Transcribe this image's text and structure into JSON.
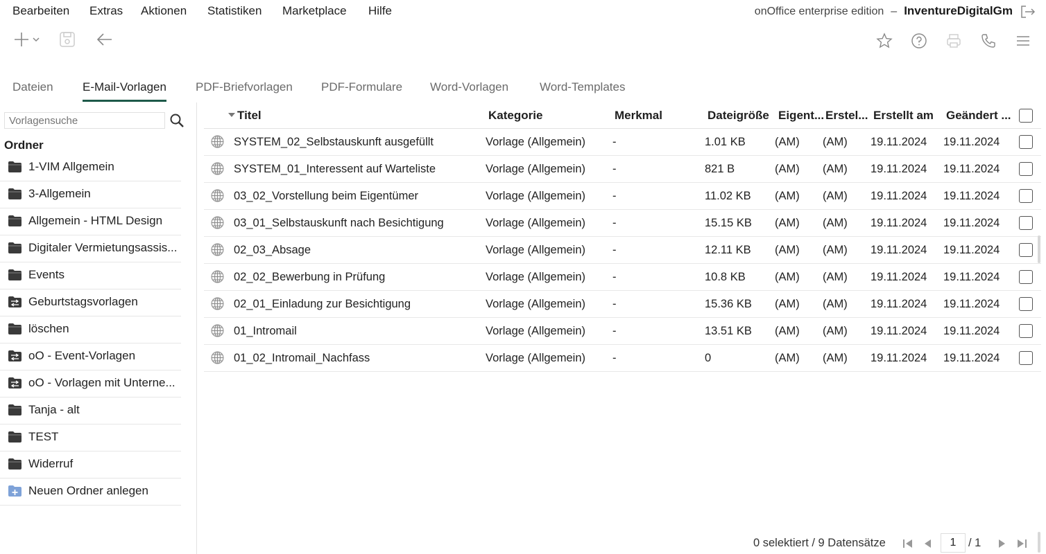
{
  "menu": {
    "items": [
      "Bearbeiten",
      "Extras",
      "Aktionen",
      "Statistiken",
      "Marketplace",
      "Hilfe"
    ],
    "edition": "onOffice enterprise edition",
    "separator": "–",
    "company": "InventureDigitalGm"
  },
  "toolbar": {
    "icons": [
      "plus-icon",
      "chevron-down-icon",
      "save-icon",
      "arrow-left-icon",
      "star-icon",
      "help-icon",
      "print-icon",
      "phone-icon",
      "menu-icon"
    ]
  },
  "tabs": [
    {
      "label": "Dateien",
      "active": false
    },
    {
      "label": "E-Mail-Vorlagen",
      "active": true
    },
    {
      "label": "PDF-Briefvorlagen",
      "active": false
    },
    {
      "label": "PDF-Formulare",
      "active": false
    },
    {
      "label": "Word-Vorlagen",
      "active": false
    },
    {
      "label": "Word-Templates",
      "active": false
    }
  ],
  "sidebar": {
    "search_placeholder": "Vorlagensuche",
    "heading": "Ordner",
    "folders": [
      {
        "label": "1-VIM Allgemein",
        "icon": "folder-icon"
      },
      {
        "label": "3-Allgemein",
        "icon": "folder-icon"
      },
      {
        "label": "Allgemein - HTML Design",
        "icon": "folder-icon"
      },
      {
        "label": "Digitaler Vermietungsassis...",
        "icon": "folder-icon"
      },
      {
        "label": "Events",
        "icon": "folder-icon"
      },
      {
        "label": "Geburtstagsvorlagen",
        "icon": "shared-folder-icon"
      },
      {
        "label": "löschen",
        "icon": "folder-icon"
      },
      {
        "label": "oO - Event-Vorlagen",
        "icon": "shared-folder-icon"
      },
      {
        "label": "oO - Vorlagen mit Unterne...",
        "icon": "shared-folder-icon"
      },
      {
        "label": "Tanja - alt",
        "icon": "folder-icon"
      },
      {
        "label": "TEST",
        "icon": "folder-icon"
      },
      {
        "label": "Widerruf",
        "icon": "folder-icon"
      },
      {
        "label": "Neuen Ordner anlegen",
        "icon": "new-folder-icon"
      }
    ]
  },
  "table": {
    "columns": [
      "Titel",
      "Kategorie",
      "Merkmal",
      "Dateigröße",
      "Eigent...",
      "Erstel...",
      "Erstellt am",
      "Geändert ..."
    ],
    "rows": [
      {
        "title": "SYSTEM_02_Selbstauskunft ausgefüllt",
        "category": "Vorlage (Allgemein)",
        "feature": "-",
        "size": "1.01 KB",
        "owner": "(AM)",
        "creator": "(AM)",
        "created": "19.11.2024",
        "changed": "19.11.2024"
      },
      {
        "title": "SYSTEM_01_Interessent auf Warteliste",
        "category": "Vorlage (Allgemein)",
        "feature": "-",
        "size": "821 B",
        "owner": "(AM)",
        "creator": "(AM)",
        "created": "19.11.2024",
        "changed": "19.11.2024"
      },
      {
        "title": "03_02_Vorstellung beim Eigentümer",
        "category": "Vorlage (Allgemein)",
        "feature": "-",
        "size": "11.02 KB",
        "owner": "(AM)",
        "creator": "(AM)",
        "created": "19.11.2024",
        "changed": "19.11.2024"
      },
      {
        "title": "03_01_Selbstauskunft nach Besichtigung",
        "category": "Vorlage (Allgemein)",
        "feature": "-",
        "size": "15.15 KB",
        "owner": "(AM)",
        "creator": "(AM)",
        "created": "19.11.2024",
        "changed": "19.11.2024"
      },
      {
        "title": "02_03_Absage",
        "category": "Vorlage (Allgemein)",
        "feature": "-",
        "size": "12.11 KB",
        "owner": "(AM)",
        "creator": "(AM)",
        "created": "19.11.2024",
        "changed": "19.11.2024"
      },
      {
        "title": "02_02_Bewerbung in Prüfung",
        "category": "Vorlage (Allgemein)",
        "feature": "-",
        "size": "10.8 KB",
        "owner": "(AM)",
        "creator": "(AM)",
        "created": "19.11.2024",
        "changed": "19.11.2024"
      },
      {
        "title": "02_01_Einladung zur Besichtigung",
        "category": "Vorlage (Allgemein)",
        "feature": "-",
        "size": "15.36 KB",
        "owner": "(AM)",
        "creator": "(AM)",
        "created": "19.11.2024",
        "changed": "19.11.2024"
      },
      {
        "title": "01_Intromail",
        "category": "Vorlage (Allgemein)",
        "feature": "-",
        "size": "13.51 KB",
        "owner": "(AM)",
        "creator": "(AM)",
        "created": "19.11.2024",
        "changed": "19.11.2024"
      },
      {
        "title": "01_02_Intromail_Nachfass",
        "category": "Vorlage (Allgemein)",
        "feature": "-",
        "size": "0",
        "owner": "(AM)",
        "creator": "(AM)",
        "created": "19.11.2024",
        "changed": "19.11.2024"
      }
    ]
  },
  "footer": {
    "status": "0 selektiert / 9 Datensätze",
    "page": "1",
    "page_total": "/ 1"
  },
  "colors": {
    "accent": "#1e5a4a",
    "folder": "#3a3a3a",
    "new_folder": "#7ea2d8"
  }
}
